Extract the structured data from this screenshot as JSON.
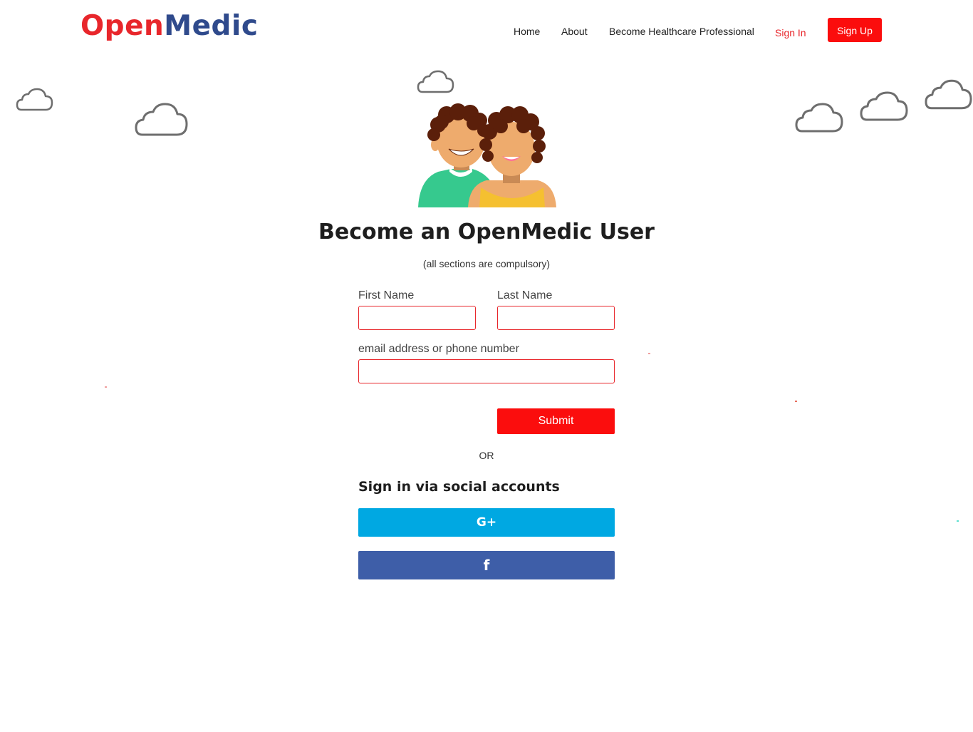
{
  "brand": {
    "part1": "Open",
    "part2": "Medic",
    "color1": "#e8262b",
    "color2": "#2f4a8c"
  },
  "nav": {
    "home": "Home",
    "about": "About",
    "become_pro": "Become Healthcare Professional",
    "sign_in": "Sign In",
    "sign_up": "Sign Up"
  },
  "main": {
    "title": "Become an OpenMedic User",
    "subtitle": "(all sections are compulsory)"
  },
  "form": {
    "first_name_label": "First Name",
    "first_name_value": "",
    "last_name_label": "Last Name",
    "last_name_value": "",
    "contact_label": "email address or phone number",
    "contact_value": "",
    "submit_label": "Submit"
  },
  "divider": {
    "or": "OR"
  },
  "social": {
    "heading": "Sign in via social accounts",
    "google_icon_text": "G+",
    "facebook_icon_text": "f",
    "google_icon": "google-plus-icon",
    "facebook_icon": "facebook-icon",
    "google_color": "#00a8e2",
    "facebook_color": "#3e5ea8"
  },
  "theme": {
    "accent": "#fb0d0d"
  }
}
